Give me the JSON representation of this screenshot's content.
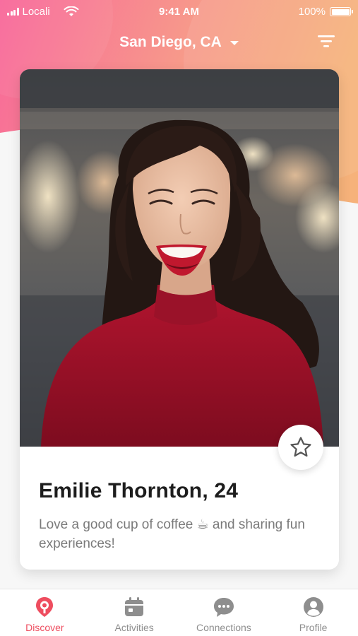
{
  "colors": {
    "gradient_pink": "#f7709b",
    "gradient_orange": "#f7b07a",
    "accent": "#ee4d5f",
    "inactive": "#8e8e8e",
    "shirt": "#a01127"
  },
  "status_bar": {
    "carrier": "Locali",
    "time": "9:41 AM",
    "battery": "100%",
    "battery_level": 1.0
  },
  "header": {
    "location": "San Diego, CA",
    "location_icon": "chevron-down-icon",
    "filter_icon": "filter-icon"
  },
  "profile_card": {
    "name_age": "Emilie Thornton, 24",
    "bio": "Love a good cup of coffee ☕ and sharing fun experiences!",
    "favorite_icon": "star-icon"
  },
  "tabs": [
    {
      "label": "Discover",
      "icon": "discover-pin-icon",
      "active": true
    },
    {
      "label": "Activities",
      "icon": "calendar-icon",
      "active": false
    },
    {
      "label": "Connections",
      "icon": "chat-icon",
      "active": false
    },
    {
      "label": "Profile",
      "icon": "person-icon",
      "active": false
    }
  ]
}
